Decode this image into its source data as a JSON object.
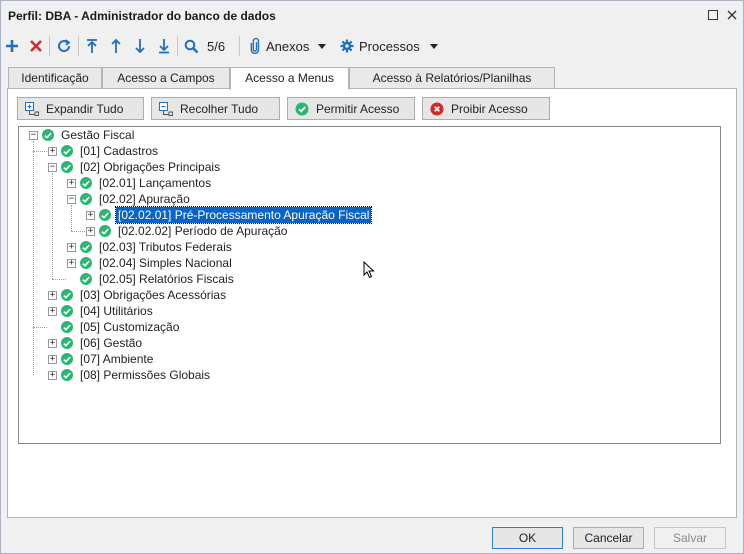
{
  "window": {
    "title": "Perfil: DBA - Administrador do banco de dados"
  },
  "toolbar": {
    "counter": "5/6",
    "anexos_label": "Anexos",
    "processos_label": "Processos"
  },
  "tabs": [
    {
      "label": "Identificação",
      "active": false
    },
    {
      "label": "Acesso a Campos",
      "active": false
    },
    {
      "label": "Acesso a Menus",
      "active": true
    },
    {
      "label": "Acesso à Relatórios/Planilhas",
      "active": false
    }
  ],
  "actions": {
    "expand_all": "Expandir Tudo",
    "collapse_all": "Recolher Tudo",
    "allow": "Permitir Acesso",
    "deny": "Proibir Acesso"
  },
  "tree": {
    "root": "Gestão Fiscal",
    "items": [
      "[01] Cadastros",
      "[02] Obrigações Principais",
      "[02.01] Lançamentos",
      "[02.02] Apuração",
      "[02.02.01] Pré-Processamento Apuração Fiscal",
      "[02.02.02] Período de Apuração",
      "[02.03] Tributos Federais",
      "[02.04] Simples Nacional",
      "[02.05] Relatórios Fiscais",
      "[03] Obrigações Acessórias",
      "[04] Utilitários",
      "[05] Customização",
      "[06] Gestão",
      "[07] Ambiente",
      "[08] Permissões Globais"
    ],
    "selected_item": "[02.02.01] Pré-Processamento Apuração Fiscal"
  },
  "footer": {
    "ok": "OK",
    "cancel": "Cancelar",
    "save": "Salvar"
  },
  "colors": {
    "check_green": "#2bb673",
    "selection_blue": "#0a64c8",
    "toolbar_blue": "#1f6fbf",
    "delete_red": "#d22b2b"
  }
}
